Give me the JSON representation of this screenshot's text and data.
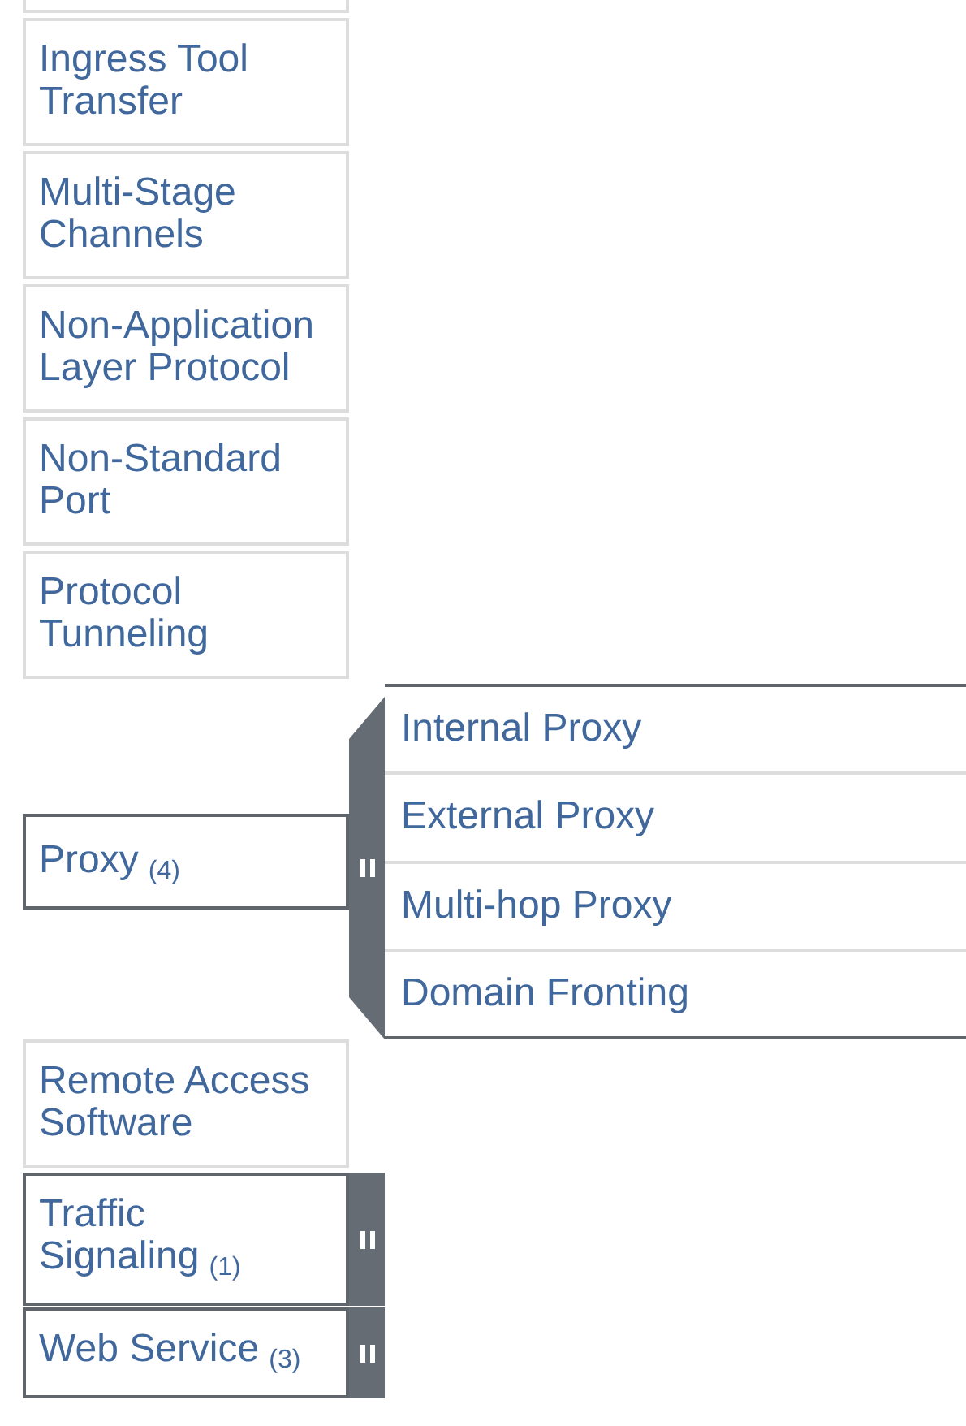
{
  "techniques": [
    {
      "name": "Ingress Tool Transfer"
    },
    {
      "name": "Multi-Stage Channels"
    },
    {
      "name": "Non-Application Layer Protocol"
    },
    {
      "name": "Non-Standard Port"
    },
    {
      "name": "Protocol Tunneling"
    },
    {
      "name": "Proxy",
      "count": "(4)",
      "expanded": true,
      "subtechniques": [
        "Internal Proxy",
        "External Proxy",
        "Multi-hop Proxy",
        "Domain Fronting"
      ]
    },
    {
      "name": "Remote Access Software"
    },
    {
      "name": "Traffic Signaling",
      "count": "(1)",
      "expanded": false
    },
    {
      "name": "Web Service",
      "count": "(3)",
      "expanded": false
    }
  ]
}
